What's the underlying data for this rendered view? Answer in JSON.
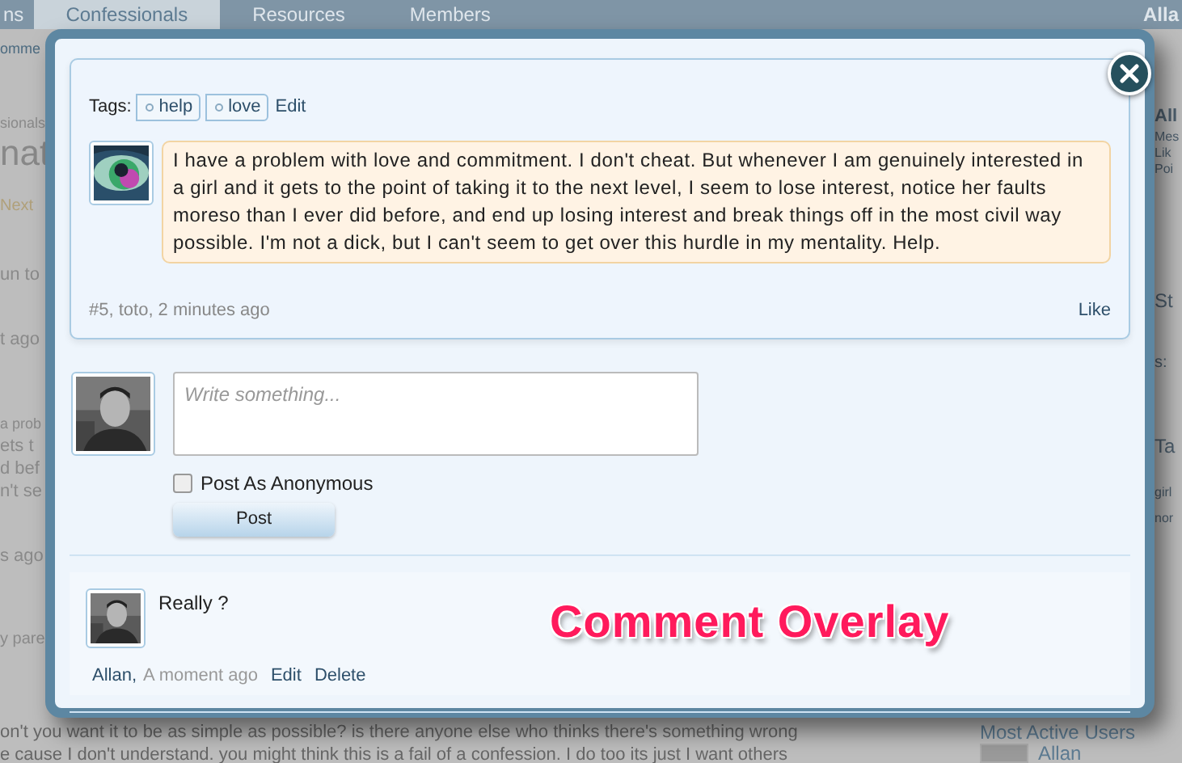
{
  "background": {
    "nav_tabs": [
      {
        "label": "ns",
        "selected": false
      },
      {
        "label": "Confessionals",
        "selected": true
      },
      {
        "label": "Resources",
        "selected": false
      },
      {
        "label": "Members",
        "selected": false
      }
    ],
    "nav_user": "Alla",
    "left_fragments": [
      "omme",
      "sionals",
      "nat",
      "Next",
      "un to",
      "t ago",
      "a prob",
      "ets t",
      "d bef",
      "n't se",
      "s ago",
      "y pare"
    ],
    "right_fragments": [
      "All",
      "Mes",
      "Lik",
      "Poi",
      "St",
      "s:",
      "Ta",
      "girl",
      "nor"
    ],
    "bottom_lines": [
      "on't you want it to be as simple as possible? is there anyone else who thinks there's something wrong",
      "e cause I don't understand. you might think this is a fail of a confession. I do too its just I want others"
    ],
    "sidebar_heading": "Most Active Users",
    "sidebar_user": "Allan"
  },
  "overlay": {
    "tags_label": "Tags:",
    "tags": [
      "help",
      "love"
    ],
    "tags_edit": "Edit",
    "post": {
      "message": "I have a problem with love and commitment. I don't cheat. But whenever I am genuinely interested in a girl and it gets to the point of taking it to the next level, I seem to lose interest, notice her faults moreso than I ever did before, and end up losing interest and break things off in the most civil way possible. I'm not a dick, but I can't seem to get over this hurdle in my mentality. Help.",
      "meta": "#5, toto, 2 minutes ago",
      "like": "Like"
    },
    "form": {
      "placeholder": "Write something...",
      "anonymous": {
        "label": "Post As Anonymous",
        "checked": false
      },
      "post_button": "Post"
    },
    "comments": [
      {
        "text": "Really ?",
        "author": "Allan,",
        "time": "A moment ago",
        "actions": [
          "Edit",
          "Delete"
        ]
      }
    ]
  },
  "annotation": "Comment Overlay"
}
